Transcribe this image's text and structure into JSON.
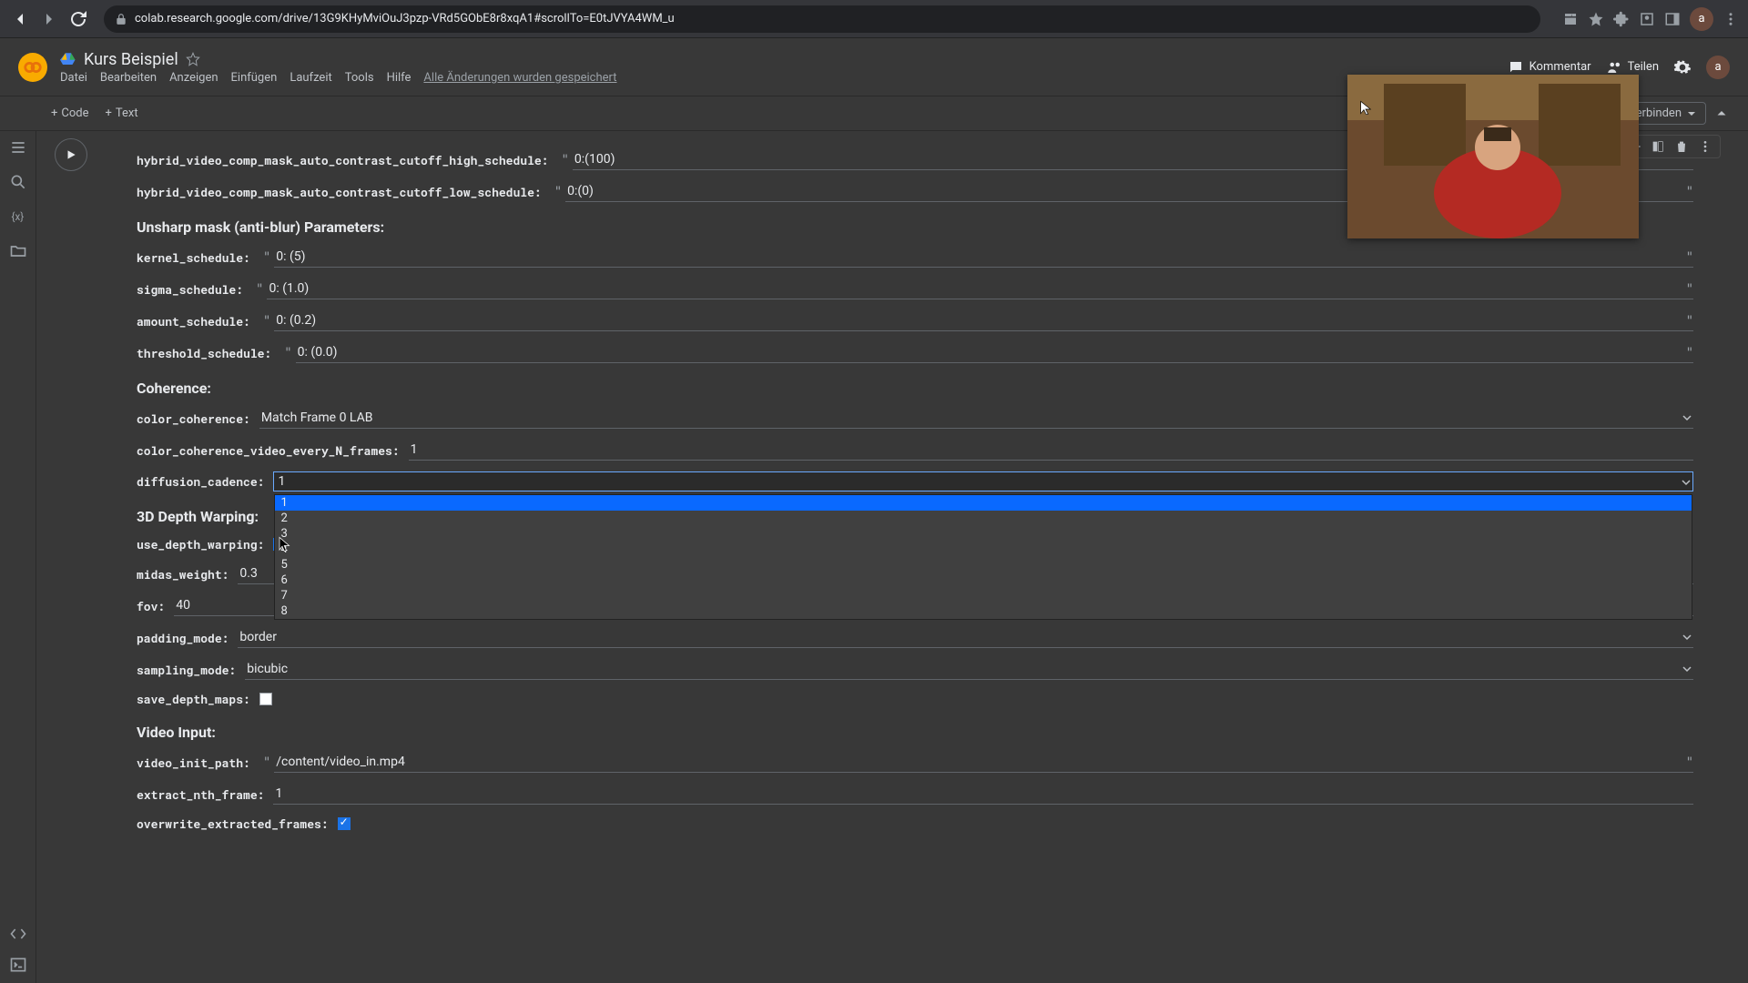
{
  "browser": {
    "url": "colab.research.google.com/drive/13G9KHyMviOuJ3pzp-VRd5GObE8r8xqA1#scrollTo=E0tJVYA4WM_u",
    "avatar": "a"
  },
  "header": {
    "title": "Kurs Beispiel",
    "menus": [
      "Datei",
      "Bearbeiten",
      "Anzeigen",
      "Einfügen",
      "Laufzeit",
      "Tools",
      "Hilfe"
    ],
    "save_status": "Alle Änderungen wurden gespeichert",
    "comment": "Kommentar",
    "share": "Teilen",
    "avatar": "a"
  },
  "toolbar": {
    "code": "Code",
    "text": "Text",
    "connect": "Verbinden"
  },
  "sections": {
    "unsharp": "Unsharp mask (anti-blur) Parameters:",
    "coherence": "Coherence:",
    "depth": "3D Depth Warping:",
    "video": "Video Input:"
  },
  "fields": {
    "cutoff_high": {
      "label": "hybrid_video_comp_mask_auto_contrast_cutoff_high_schedule:",
      "value": "0:(100)"
    },
    "cutoff_low": {
      "label": "hybrid_video_comp_mask_auto_contrast_cutoff_low_schedule:",
      "value": "0:(0)"
    },
    "kernel": {
      "label": "kernel_schedule:",
      "value": "0: (5)"
    },
    "sigma": {
      "label": "sigma_schedule:",
      "value": "0: (1.0)"
    },
    "amount": {
      "label": "amount_schedule:",
      "value": "0: (0.2)"
    },
    "threshold": {
      "label": "threshold_schedule:",
      "value": "0: (0.0)"
    },
    "color_coherence": {
      "label": "color_coherence:",
      "value": "Match Frame 0 LAB"
    },
    "cc_every_n": {
      "label": "color_coherence_video_every_N_frames:",
      "value": "1"
    },
    "diffusion_cadence": {
      "label": "diffusion_cadence:",
      "value": "1",
      "options": [
        "1",
        "2",
        "3",
        "4",
        "5",
        "6",
        "7",
        "8"
      ]
    },
    "use_depth": {
      "label": "use_depth_warping:"
    },
    "midas": {
      "label": "midas_weight:",
      "value": "0.3"
    },
    "fov": {
      "label": "fov:",
      "value": "40"
    },
    "padding": {
      "label": "padding_mode:",
      "value": "border"
    },
    "sampling": {
      "label": "sampling_mode:",
      "value": "bicubic"
    },
    "save_depth": {
      "label": "save_depth_maps:"
    },
    "video_init": {
      "label": "video_init_path:",
      "value": "/content/video_in.mp4"
    },
    "extract_nth": {
      "label": "extract_nth_frame:",
      "value": "1"
    },
    "overwrite": {
      "label": "overwrite_extracted_frames:"
    }
  }
}
